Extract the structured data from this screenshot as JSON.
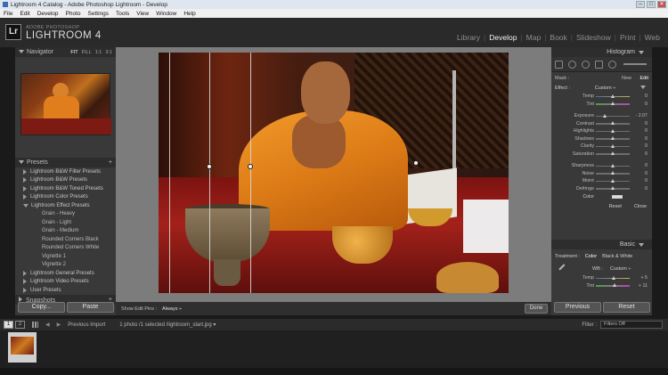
{
  "window": {
    "title": "Lightroom 4 Catalog - Adobe Photoshop Lightroom - Develop",
    "controls": [
      "–",
      "□",
      "✕"
    ]
  },
  "menu": [
    "File",
    "Edit",
    "Develop",
    "Photo",
    "Settings",
    "Tools",
    "View",
    "Window",
    "Help"
  ],
  "brand": {
    "logo": "Lr",
    "sub": "ADOBE PHOTOSHOP",
    "name": "LIGHTROOM 4"
  },
  "modules": [
    {
      "label": "Library"
    },
    {
      "label": "Develop",
      "active": true
    },
    {
      "label": "Map"
    },
    {
      "label": "Book"
    },
    {
      "label": "Slideshow"
    },
    {
      "label": "Print"
    },
    {
      "label": "Web"
    }
  ],
  "navigator": {
    "title": "Navigator",
    "zoom": [
      "FIT",
      "FILL",
      "1:1",
      "3:1"
    ]
  },
  "presets": {
    "title": "Presets",
    "add": "+",
    "items": [
      {
        "label": "Lightroom B&W Filter Presets",
        "level": 0,
        "open": false
      },
      {
        "label": "Lightroom B&W Presets",
        "level": 0,
        "open": false
      },
      {
        "label": "Lightroom B&W Toned Presets",
        "level": 0,
        "open": false
      },
      {
        "label": "Lightroom Color Presets",
        "level": 0,
        "open": false
      },
      {
        "label": "Lightroom Effect Presets",
        "level": 0,
        "open": true
      },
      {
        "label": "Grain - Heavy",
        "level": 1
      },
      {
        "label": "Grain - Light",
        "level": 1
      },
      {
        "label": "Grain - Medium",
        "level": 1
      },
      {
        "label": "Rounded Corners Black",
        "level": 1
      },
      {
        "label": "Rounded Corners White",
        "level": 1
      },
      {
        "label": "Vignette 1",
        "level": 1
      },
      {
        "label": "Vignette 2",
        "level": 1
      },
      {
        "label": "Lightroom General Presets",
        "level": 0,
        "open": false
      },
      {
        "label": "Lightroom Video Presets",
        "level": 0,
        "open": false
      },
      {
        "label": "User Presets",
        "level": 0,
        "open": false
      }
    ]
  },
  "snapshots": {
    "title": "Snapshots",
    "add": "+"
  },
  "left_buttons": {
    "copy": "Copy...",
    "paste": "Paste"
  },
  "histogram": {
    "title": "Histogram"
  },
  "mask": {
    "label": "Mask :",
    "new": "New",
    "edit": "Edit"
  },
  "effect": {
    "label": "Effect :",
    "value": "Custom ÷"
  },
  "adjustments": [
    {
      "label": "Temp",
      "value": "0",
      "pos": 0.5
    },
    {
      "label": "Tint",
      "value": "0",
      "pos": 0.5
    },
    {
      "label": "Exposure",
      "value": "- 2.07",
      "pos": 0.28
    },
    {
      "label": "Contrast",
      "value": "0",
      "pos": 0.5
    },
    {
      "label": "Highlights",
      "value": "0",
      "pos": 0.5
    },
    {
      "label": "Shadows",
      "value": "0",
      "pos": 0.5
    },
    {
      "label": "Clarity",
      "value": "0",
      "pos": 0.5
    },
    {
      "label": "Saturation",
      "value": "0",
      "pos": 0.5
    },
    {
      "label": "Sharpness",
      "value": "0",
      "pos": 0.5
    },
    {
      "label": "Noise",
      "value": "0",
      "pos": 0.5
    },
    {
      "label": "Moiré",
      "value": "0",
      "pos": 0.5
    },
    {
      "label": "Defringe",
      "value": "0",
      "pos": 0.5
    }
  ],
  "color": {
    "label": "Color"
  },
  "panel_actions": {
    "reset": "Reset",
    "close": "Close"
  },
  "basic": {
    "title": "Basic",
    "treatment_label": "Treatment :",
    "color": "Color",
    "bw": "Black & White",
    "wb_label": "WB :",
    "wb_value": "Custom ÷",
    "temp": {
      "label": "Temp",
      "value": "+ 5",
      "pos": 0.53
    },
    "tint": {
      "label": "Tint",
      "value": "+ 11",
      "pos": 0.56
    }
  },
  "right_buttons": {
    "previous": "Previous",
    "reset": "Reset"
  },
  "toolbar": {
    "show_pins_label": "Show Edit Pins :",
    "show_pins_value": "Always ÷",
    "done": "Done"
  },
  "filmstrip_bar": {
    "pages": [
      "1",
      "2"
    ],
    "source": "Previous Import",
    "info": "1 photo /1 selected /lightroom_start.jpg ▾",
    "filter_label": "Filter :",
    "filter_value": "Filters Off"
  },
  "colors": {
    "panel_bg": "#393939",
    "photo_bg": "#7c7c7c",
    "accent_text": "#f2f2f2"
  }
}
